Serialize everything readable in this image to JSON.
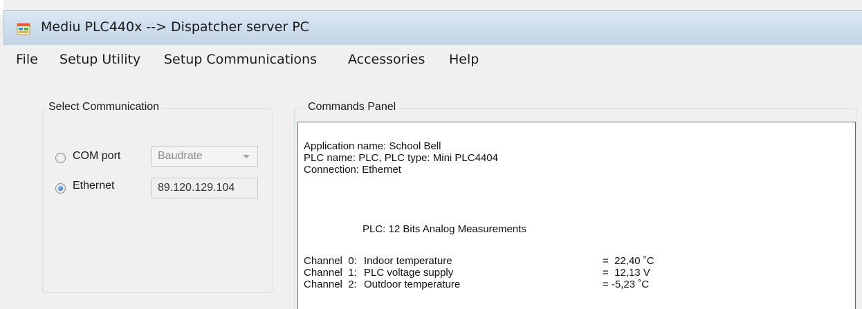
{
  "window": {
    "title": "Mediu PLC440x --> Dispatcher server PC"
  },
  "menu": {
    "items": [
      "File",
      "Setup Utility",
      "Setup Communications",
      "Accessories",
      "Help"
    ]
  },
  "select_communication": {
    "title": "Select Communication",
    "com_port": {
      "label": "COM port",
      "selected": false,
      "baudrate_placeholder": "Baudrate"
    },
    "ethernet": {
      "label": "Ethernet",
      "selected": true,
      "ip_address": "89.120.129.104"
    }
  },
  "commands_panel": {
    "title": "Commands Panel",
    "application_line": "Application name: School Bell",
    "plc_line": "PLC name: PLC, PLC type: Mini PLC4404",
    "connection_line": "Connection: Ethernet",
    "measurements_header": "PLC: 12 Bits Analog Measurements",
    "channels": [
      {
        "channel": "Channel  0:",
        "name": "Indoor temperature",
        "value": "=  22,40 ˚C"
      },
      {
        "channel": "Channel  1:",
        "name": "PLC voltage supply",
        "value": "=  12,13 V"
      },
      {
        "channel": "Channel  2:",
        "name": "Outdoor temperature",
        "value": "= -5,23 ˚C"
      }
    ]
  },
  "icons": {
    "app_icon": "window-app-icon",
    "radio_selected_color": "#2a6fb8"
  }
}
